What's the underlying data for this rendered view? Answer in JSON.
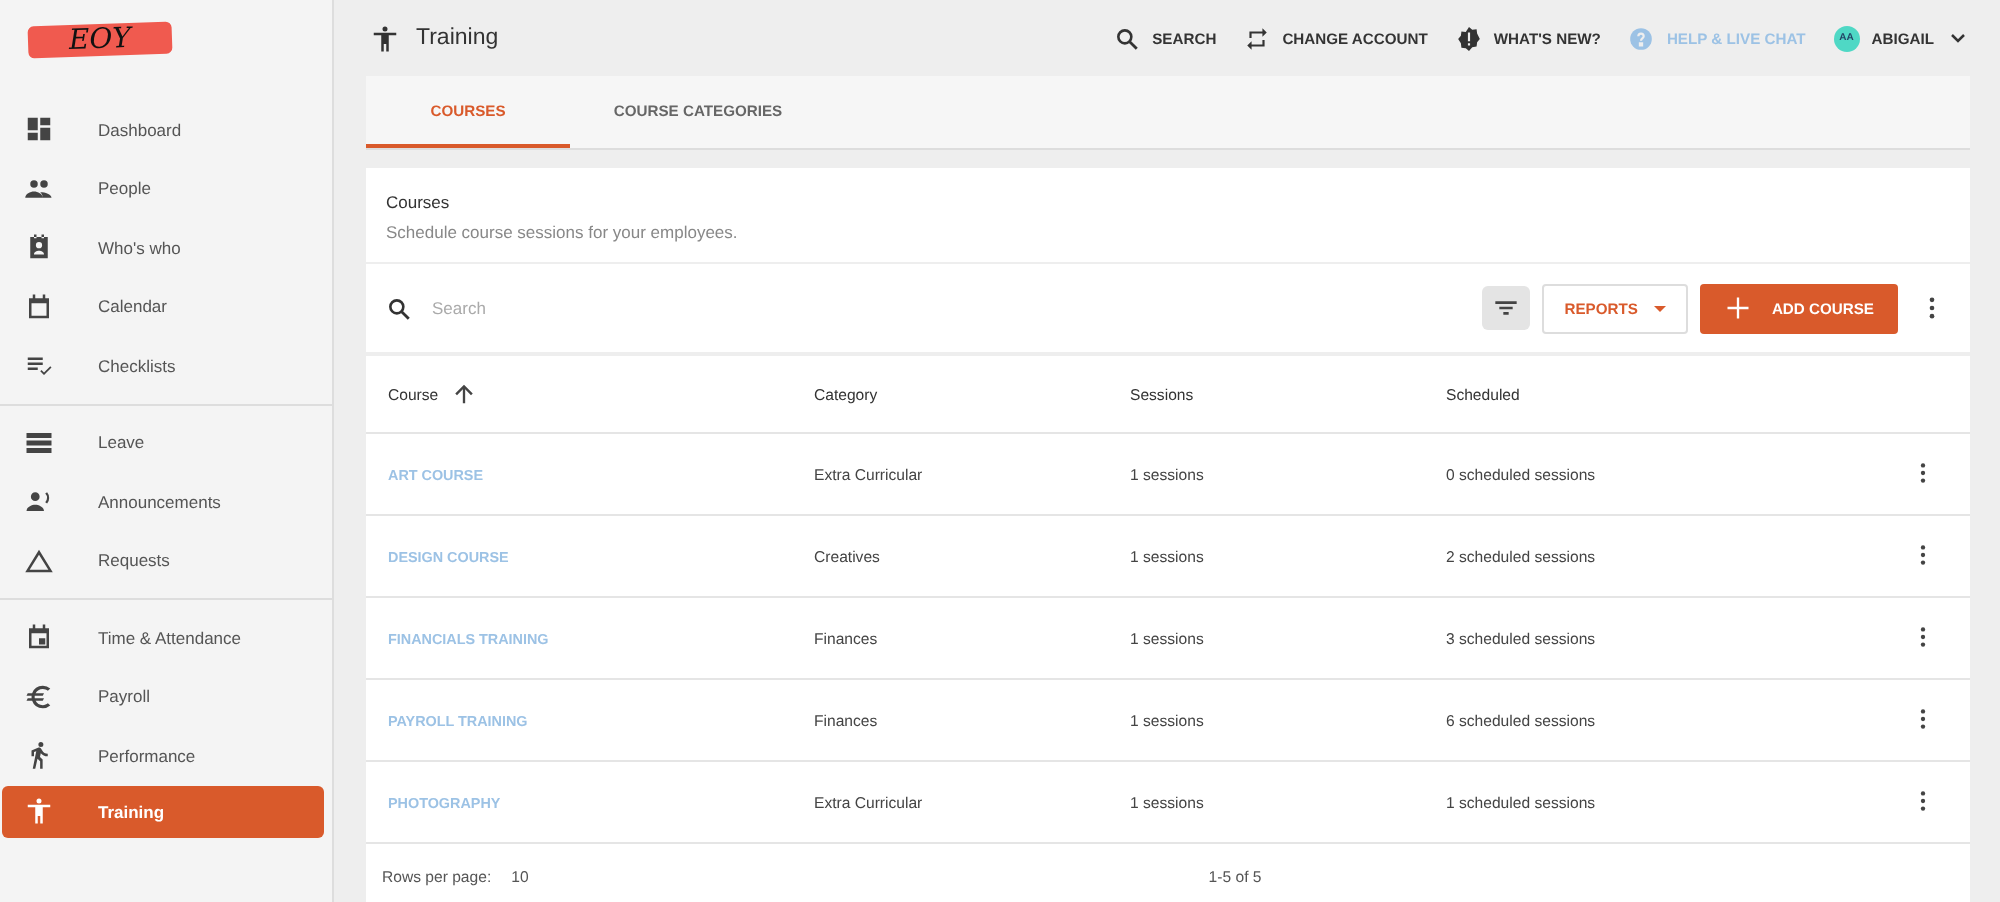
{
  "logo": {
    "text": "EOY"
  },
  "sidebar": {
    "groups": [
      {
        "items": [
          {
            "label": "Dashboard",
            "selected": false
          },
          {
            "label": "People",
            "selected": false
          },
          {
            "label": "Who's who",
            "selected": false
          },
          {
            "label": "Calendar",
            "selected": false
          },
          {
            "label": "Checklists",
            "selected": false
          }
        ]
      },
      {
        "items": [
          {
            "label": "Leave",
            "selected": false
          },
          {
            "label": "Announcements",
            "selected": false
          },
          {
            "label": "Requests",
            "selected": false
          }
        ]
      },
      {
        "items": [
          {
            "label": "Time & Attendance",
            "selected": false
          },
          {
            "label": "Payroll",
            "selected": false
          },
          {
            "label": "Performance",
            "selected": false
          },
          {
            "label": "Training",
            "selected": true
          }
        ]
      }
    ]
  },
  "header": {
    "title": "Training",
    "actions": [
      {
        "label": "SEARCH",
        "disabled": false
      },
      {
        "label": "CHANGE ACCOUNT",
        "disabled": false
      },
      {
        "label": "WHAT'S NEW?",
        "disabled": false
      },
      {
        "label": "HELP & LIVE CHAT",
        "disabled": true
      }
    ],
    "user": {
      "initials": "AA",
      "name": "ABIGAIL"
    }
  },
  "tabs": [
    {
      "label": "COURSES",
      "selected": true
    },
    {
      "label": "COURSE CATEGORIES",
      "selected": false
    }
  ],
  "card": {
    "title": "Courses",
    "subtitle": "Schedule course sessions for your employees.",
    "search": {
      "placeholder": "Search"
    },
    "reports_button": "REPORTS",
    "add_button": "ADD COURSE"
  },
  "table": {
    "columns": [
      "Course",
      "Category",
      "Sessions",
      "Scheduled"
    ],
    "rows": [
      {
        "course": "ART COURSE",
        "category": "Extra Curricular",
        "sessions": "1 sessions",
        "scheduled": "0 scheduled sessions"
      },
      {
        "course": "DESIGN COURSE",
        "category": "Creatives",
        "sessions": "1 sessions",
        "scheduled": "2 scheduled sessions"
      },
      {
        "course": "FINANCIALS TRAINING",
        "category": "Finances",
        "sessions": "1 sessions",
        "scheduled": "3 scheduled sessions"
      },
      {
        "course": "PAYROLL TRAINING",
        "category": "Finances",
        "sessions": "1 sessions",
        "scheduled": "6 scheduled sessions"
      },
      {
        "course": "PHOTOGRAPHY",
        "category": "Extra Curricular",
        "sessions": "1 sessions",
        "scheduled": "1 scheduled sessions"
      }
    ]
  },
  "pagination": {
    "rows_per_page_label": "Rows per page:",
    "rows_per_page": "10",
    "range": "1-5 of 5"
  }
}
